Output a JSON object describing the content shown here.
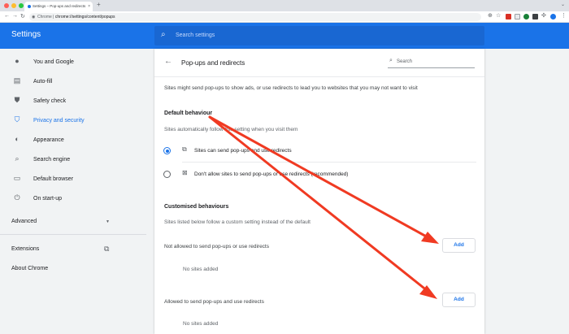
{
  "browser": {
    "tab_title": "Settings – Pop-ups and redirects",
    "tab_close": "×",
    "new_tab": "+",
    "url_host": "Chrome",
    "url_sep": " | ",
    "url_path": "chrome://settings/content/popups",
    "icons": [
      "back-icon",
      "forward-icon",
      "reload-icon",
      "zoom-icon",
      "star-icon",
      "extension-icons",
      "puzzle-icon",
      "profile-avatar",
      "menu-icon"
    ]
  },
  "header": {
    "title": "Settings",
    "search_placeholder": "Search settings"
  },
  "sidebar": {
    "items": [
      {
        "label": "You and Google",
        "icon": "person-icon"
      },
      {
        "label": "Auto-fill",
        "icon": "clipboard-icon"
      },
      {
        "label": "Safety check",
        "icon": "shield-check-icon"
      },
      {
        "label": "Privacy and security",
        "icon": "shield-icon",
        "active": true
      },
      {
        "label": "Appearance",
        "icon": "palette-icon"
      },
      {
        "label": "Search engine",
        "icon": "search-icon"
      },
      {
        "label": "Default browser",
        "icon": "browser-icon"
      },
      {
        "label": "On start-up",
        "icon": "power-icon"
      }
    ],
    "advanced": "Advanced",
    "extensions": "Extensions",
    "about": "About Chrome"
  },
  "main": {
    "title": "Pop-ups and redirects",
    "search_placeholder": "Search",
    "description": "Sites might send pop-ups to show ads, or use redirects to lead you to websites that you may not want to visit",
    "default_heading": "Default behaviour",
    "default_sub": "Sites automatically follow this setting when you visit them",
    "option_allow": "Sites can send pop-ups and use redirects",
    "option_block": "Don't allow sites to send pop-ups or use redirects (recommended)",
    "custom_heading": "Customised behaviours",
    "custom_sub": "Sites listed below follow a custom setting instead of the default",
    "blocked_heading": "Not allowed to send pop-ups or use redirects",
    "blocked_empty": "No sites added",
    "allowed_heading": "Allowed to send pop-ups and use redirects",
    "allowed_empty": "No sites added",
    "add_label": "Add"
  },
  "colors": {
    "accent": "#1a73e8",
    "annotation_arrow": "#f03a22"
  }
}
